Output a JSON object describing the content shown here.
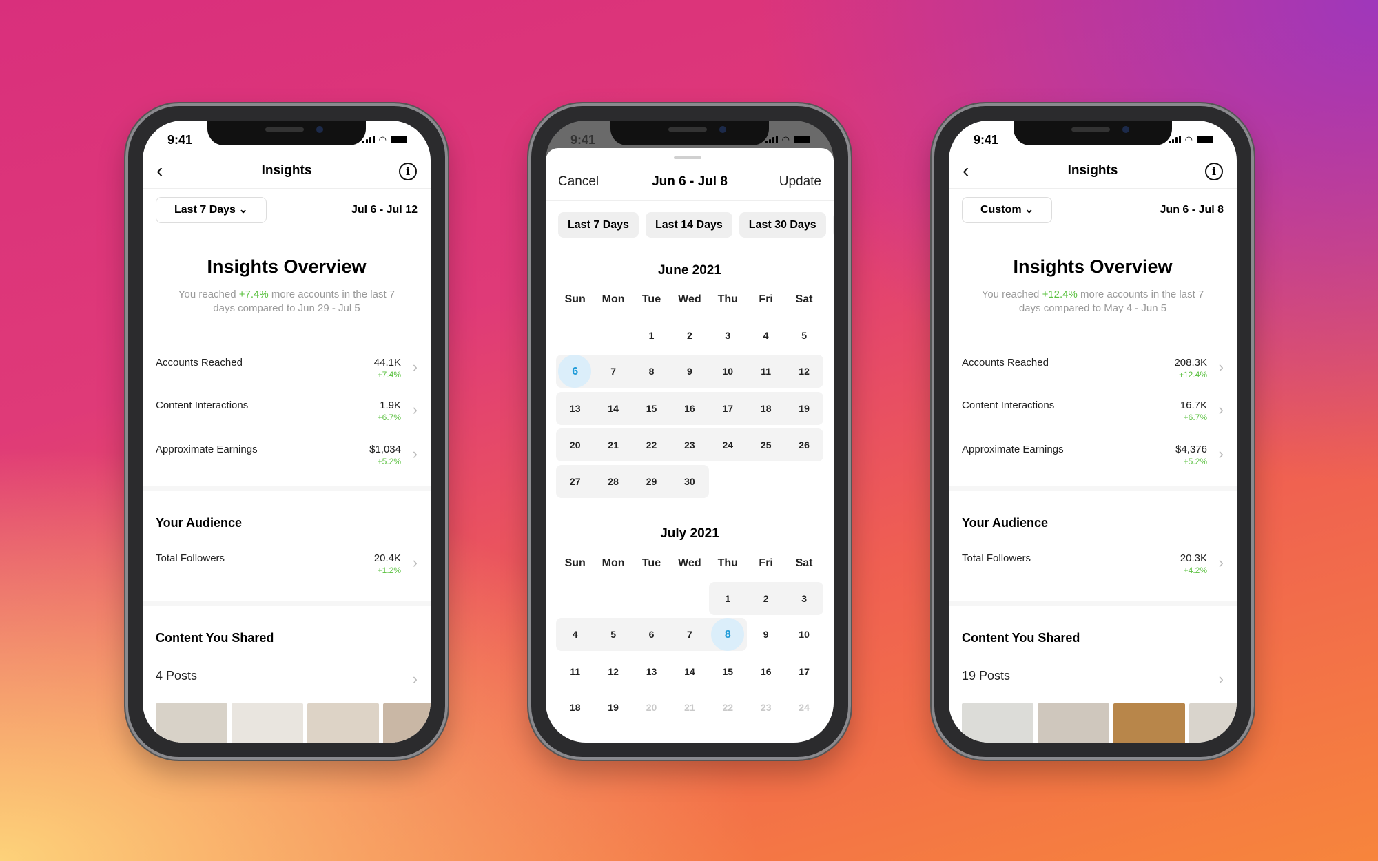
{
  "status_time": "9:41",
  "phones": [
    {
      "nav_title": "Insights",
      "dropdown_label": "Last 7 Days",
      "date_range": "Jul 6 - Jul 12",
      "overview_title": "Insights Overview",
      "overview_text_before": "You reached ",
      "overview_pct": "+7.4%",
      "overview_text_after": " more accounts in the last 7 days compared to Jun 29 - Jul 5",
      "metrics": [
        {
          "label": "Accounts Reached",
          "value": "44.1K",
          "change": "+7.4%"
        },
        {
          "label": "Content Interactions",
          "value": "1.9K",
          "change": "+6.7%"
        },
        {
          "label": "Approximate Earnings",
          "value": "$1,034",
          "change": "+5.2%"
        }
      ],
      "audience_title": "Your Audience",
      "audience": {
        "label": "Total Followers",
        "value": "20.4K",
        "change": "+1.2%"
      },
      "content_title": "Content You Shared",
      "posts": "4 Posts",
      "thumb_colors": [
        "#d8d2c8",
        "#e9e5df",
        "#ddd3c6",
        "#c9b7a5"
      ]
    },
    {
      "nav_title": "Insights",
      "dropdown_label": "Custom",
      "date_range": "Jun 6 - Jul 8",
      "overview_title": "Insights Overview",
      "overview_text_before": "You reached ",
      "overview_pct": "+12.4%",
      "overview_text_after": " more accounts in the last 7 days compared to May 4 - Jun 5",
      "metrics": [
        {
          "label": "Accounts Reached",
          "value": "208.3K",
          "change": "+12.4%"
        },
        {
          "label": "Content Interactions",
          "value": "16.7K",
          "change": "+6.7%"
        },
        {
          "label": "Approximate Earnings",
          "value": "$4,376",
          "change": "+5.2%"
        }
      ],
      "audience_title": "Your Audience",
      "audience": {
        "label": "Total Followers",
        "value": "20.3K",
        "change": "+4.2%"
      },
      "content_title": "Content You Shared",
      "posts": "19 Posts",
      "thumb_colors": [
        "#dcdcd8",
        "#cfc7bd",
        "#b8864a",
        "#d9d4cc"
      ]
    }
  ],
  "picker": {
    "cancel": "Cancel",
    "title": "Jun 6 - Jul 8",
    "update": "Update",
    "chips": [
      "Last 7 Days",
      "Last 14 Days",
      "Last 30 Days"
    ],
    "weekdays": [
      "Sun",
      "Mon",
      "Tue",
      "Wed",
      "Thu",
      "Fri",
      "Sat"
    ],
    "selected_color": "#1f9bd8",
    "months": [
      {
        "title": "June 2021",
        "weeks": [
          [
            null,
            null,
            1,
            2,
            3,
            4,
            5
          ],
          [
            6,
            7,
            8,
            9,
            10,
            11,
            12
          ],
          [
            13,
            14,
            15,
            16,
            17,
            18,
            19
          ],
          [
            20,
            21,
            22,
            23,
            24,
            25,
            26
          ],
          [
            27,
            28,
            29,
            30,
            null,
            null,
            null
          ]
        ],
        "range_from": 6,
        "range_to": 30,
        "selected": [
          6
        ],
        "disabled": []
      },
      {
        "title": "July 2021",
        "weeks": [
          [
            null,
            null,
            null,
            null,
            1,
            2,
            3
          ],
          [
            4,
            5,
            6,
            7,
            8,
            9,
            10
          ],
          [
            11,
            12,
            13,
            14,
            15,
            16,
            17
          ],
          [
            18,
            19,
            20,
            21,
            22,
            23,
            24
          ]
        ],
        "range_from": 1,
        "range_to": 8,
        "selected": [
          8
        ],
        "disabled": [
          20,
          21,
          22,
          23,
          24
        ]
      }
    ]
  }
}
